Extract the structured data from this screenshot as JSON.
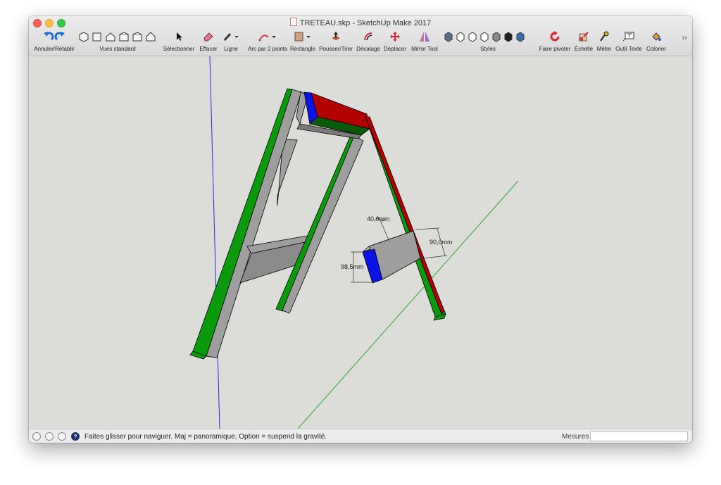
{
  "window": {
    "title": "TRETEAU.skp - SketchUp Make 2017"
  },
  "toolbar": {
    "undo_redo": "Annuler/Rétablir",
    "standard_views": "Vues standard",
    "select": "Sélectionner",
    "eraser": "Effacer",
    "line": "Ligne",
    "arc": "Arc par 2 points",
    "rectangle": "Rectangle",
    "push_pull": "Pousser/Tirer",
    "offset": "Décalage",
    "move": "Déplacer",
    "mirror": "Mirror Tool",
    "styles": "Styles",
    "rotate": "Faire pivoter",
    "scale": "Échelle",
    "tape": "Mètre",
    "text": "Outil Texte",
    "paint": "Colorier",
    "overflow": "››"
  },
  "model": {
    "dim_width": "40,0mm",
    "dim_height": "90,0mm",
    "dim_depth": "98,5mm"
  },
  "status": {
    "help_icon": "?",
    "message": "Faites glisser pour naviguer. Maj = panoramique, Option =  suspend la gravité.",
    "measures_label": "Mesures",
    "measures_value": ""
  },
  "colors": {
    "green": "#0b9a0b",
    "red": "#b30000",
    "blue": "#0a14e6",
    "gray": "#9e9e9e",
    "viewport_bg": "#dcdcd9"
  }
}
